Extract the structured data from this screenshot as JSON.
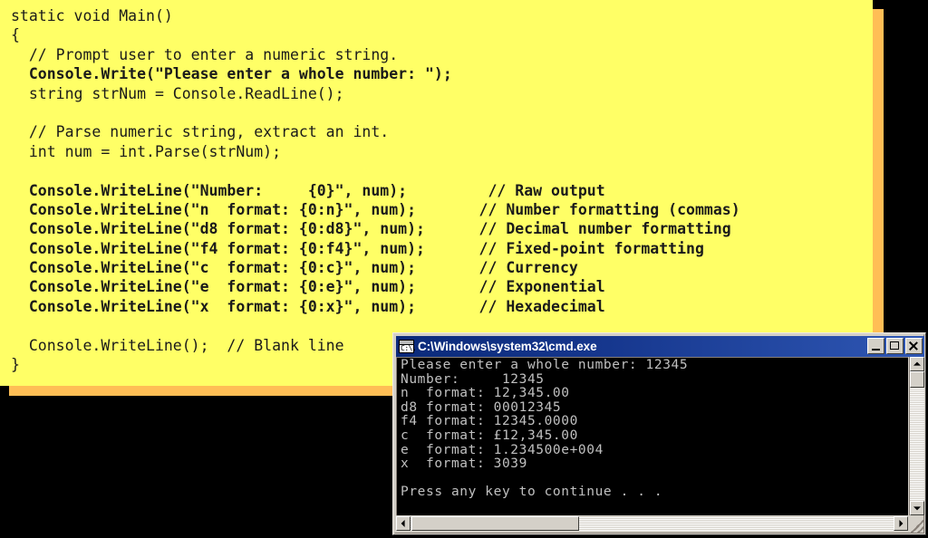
{
  "slide": {
    "background_color": "#000000",
    "panel_color": "#ffff66",
    "panel_shadow_color": "#ffbe55",
    "code_lines": [
      {
        "text": "static void Main()",
        "bold": false
      },
      {
        "text": "{",
        "bold": false
      },
      {
        "text": "  // Prompt user to enter a numeric string.",
        "bold": false
      },
      {
        "text": "  Console.Write(\"Please enter a whole number: \");",
        "bold": true
      },
      {
        "text": "  string strNum = Console.ReadLine();",
        "bold": false
      },
      {
        "text": "",
        "bold": false
      },
      {
        "text": "  // Parse numeric string, extract an int.",
        "bold": false
      },
      {
        "text": "  int num = int.Parse(strNum);",
        "bold": false
      },
      {
        "text": "",
        "bold": false
      },
      {
        "text": "  Console.WriteLine(\"Number:     {0}\", num);         // Raw output",
        "bold": true
      },
      {
        "text": "  Console.WriteLine(\"n  format: {0:n}\", num);       // Number formatting (commas)",
        "bold": true
      },
      {
        "text": "  Console.WriteLine(\"d8 format: {0:d8}\", num);      // Decimal number formatting",
        "bold": true
      },
      {
        "text": "  Console.WriteLine(\"f4 format: {0:f4}\", num);      // Fixed-point formatting",
        "bold": true
      },
      {
        "text": "  Console.WriteLine(\"c  format: {0:c}\", num);       // Currency",
        "bold": true
      },
      {
        "text": "  Console.WriteLine(\"e  format: {0:e}\", num);       // Exponential",
        "bold": true
      },
      {
        "text": "  Console.WriteLine(\"x  format: {0:x}\", num);       // Hexadecimal",
        "bold": true
      },
      {
        "text": "",
        "bold": false
      },
      {
        "text": "  Console.WriteLine();  // Blank line",
        "bold": false
      },
      {
        "text": "}",
        "bold": false
      }
    ]
  },
  "console_window": {
    "title": "C:\\Windows\\system32\\cmd.exe",
    "icon": "cmd-prompt-icon",
    "icon_glyph": "C:\\.",
    "titlebar_color": "#16378e",
    "screen_background": "#000000",
    "screen_foreground": "#c0c0c0",
    "buttons": {
      "minimize": "Minimize",
      "maximize": "Maximize",
      "close": "Close"
    },
    "output_lines": [
      "Please enter a whole number: 12345",
      "Number:     12345",
      "n  format: 12,345.00",
      "d8 format: 00012345",
      "f4 format: 12345.0000",
      "c  format: £12,345.00",
      "e  format: 1.234500e+004",
      "x  format: 3039",
      "",
      "Press any key to continue . . ."
    ],
    "scrollbars": {
      "vertical_up": "scroll-up-arrow",
      "vertical_down": "scroll-down-arrow",
      "horizontal_left": "scroll-left-arrow",
      "horizontal_right": "scroll-right-arrow"
    }
  }
}
